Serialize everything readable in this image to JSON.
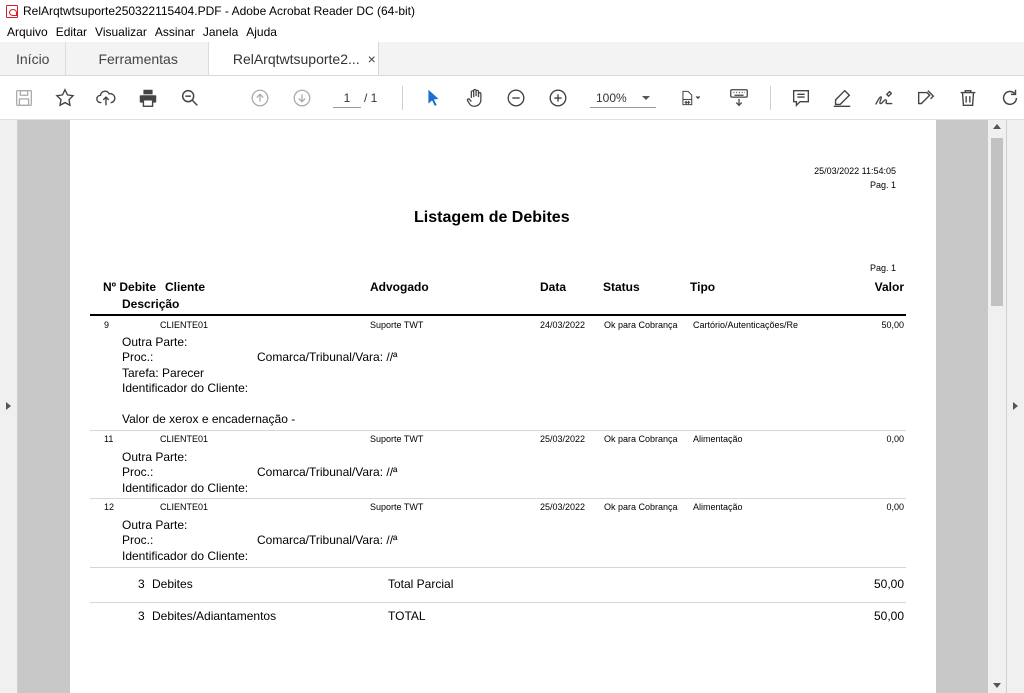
{
  "window": {
    "title": "RelArqtwtsuporte250322115404.PDF - Adobe Acrobat Reader DC (64-bit)"
  },
  "menu": [
    "Arquivo",
    "Editar",
    "Visualizar",
    "Assinar",
    "Janela",
    "Ajuda"
  ],
  "tabs": {
    "home": "Início",
    "tools": "Ferramentas",
    "document": "RelArqtwtsuporte2...",
    "close": "×"
  },
  "toolbar": {
    "page_current": "1",
    "page_total": "/ 1",
    "zoom": "100%"
  },
  "report": {
    "datetime": "25/03/2022 11:54:05",
    "page_top": "Pag. 1",
    "title": "Listagem de Debites",
    "page_header": "Pag. 1",
    "columns": {
      "num_debite": "Nº Debite",
      "cliente": "Cliente",
      "descricao": "Descrição",
      "advogado": "Advogado",
      "data": "Data",
      "status": "Status",
      "tipo": "Tipo",
      "valor": "Valor"
    },
    "rows": [
      {
        "num": "9",
        "cliente": "CLIENTE01",
        "advogado": "Suporte TWT",
        "data": "24/03/2022",
        "status": "Ok para Cobrança",
        "tipo": "Cartório/Autenticações/Re",
        "valor": "50,00",
        "outra_parte": "Outra Parte:",
        "proc": "Proc.:",
        "comarca": "Comarca/Tribunal/Vara: //ª",
        "tarefa": "Tarefa: Parecer",
        "identificador": "Identificador do Cliente:",
        "descricao": "Valor de xerox e encadernação -"
      },
      {
        "num": "11",
        "cliente": "CLIENTE01",
        "advogado": "Suporte TWT",
        "data": "25/03/2022",
        "status": "Ok para Cobrança",
        "tipo": "Alimentação",
        "valor": "0,00",
        "outra_parte": "Outra Parte:",
        "proc": "Proc.:",
        "comarca": "Comarca/Tribunal/Vara: //ª",
        "identificador": "Identificador do Cliente:"
      },
      {
        "num": "12",
        "cliente": "CLIENTE01",
        "advogado": "Suporte TWT",
        "data": "25/03/2022",
        "status": "Ok para Cobrança",
        "tipo": "Alimentação",
        "valor": "0,00",
        "outra_parte": "Outra Parte:",
        "proc": "Proc.:",
        "comarca": "Comarca/Tribunal/Vara: //ª",
        "identificador": "Identificador do Cliente:"
      }
    ],
    "totals": [
      {
        "count": "3",
        "label": "Debites",
        "kind": "Total Parcial",
        "valor": "50,00"
      },
      {
        "count": "3",
        "label": "Debites/Adiantamentos",
        "kind": "TOTAL",
        "valor": "50,00"
      }
    ]
  }
}
